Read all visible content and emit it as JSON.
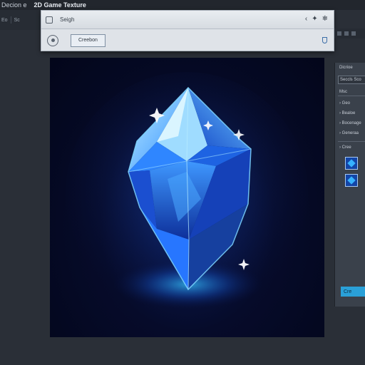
{
  "app": {
    "menu_left": "Decion e",
    "document_title": "2D Game Texture",
    "left_toolbar": [
      "Eo",
      "Sc"
    ]
  },
  "dialog": {
    "header_label": "Seigh",
    "button_label": "Creebon"
  },
  "panel": {
    "title": "Dicrioe",
    "selector": "Seccls Sco",
    "section_label": "Msc",
    "items": [
      "Geo",
      "Bealoe",
      "Bocenage",
      "Generaa"
    ],
    "swatch_section": "Cree",
    "create_button": "Cre"
  },
  "colors": {
    "accent": "#2aa0d8",
    "crystal_core": "#2f8cff",
    "crystal_glow": "#7fd6ff",
    "background_canvas": "#060b2a"
  }
}
